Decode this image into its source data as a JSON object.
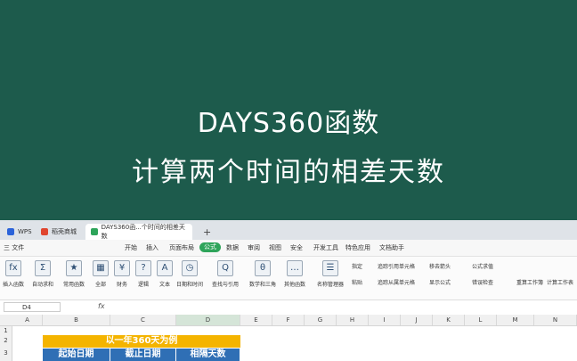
{
  "banner": {
    "line1": "DAYS360函数",
    "line2": "计算两个时间的相差天数"
  },
  "tabs": [
    {
      "label": "WPS"
    },
    {
      "label": "稻壳商城"
    },
    {
      "label": "DAYS360函...个时间的相差天数"
    }
  ],
  "menu": [
    "三 文件",
    "开始",
    "插入",
    "页面布局",
    "公式",
    "数据",
    "审阅",
    "视图",
    "安全",
    "开发工具",
    "特色应用",
    "文档助手"
  ],
  "ribbon": [
    {
      "icon": "fx",
      "label": "插入函数"
    },
    {
      "icon": "Σ",
      "label": "自动求和"
    },
    {
      "icon": "★",
      "label": "常用函数"
    },
    {
      "icon": "▦",
      "label": "全部"
    },
    {
      "icon": "¥",
      "label": "财务"
    },
    {
      "icon": "?",
      "label": "逻辑"
    },
    {
      "icon": "A",
      "label": "文本"
    },
    {
      "icon": "◷",
      "label": "日期和时间"
    },
    {
      "icon": "Q",
      "label": "查找与引用"
    },
    {
      "icon": "θ",
      "label": "数学和三角"
    },
    {
      "icon": "…",
      "label": "其他函数"
    },
    {
      "icon": "☰",
      "label": "名称管理器"
    }
  ],
  "ribbon_small": [
    "指定",
    "粘贴",
    "追踪引用单元格",
    "追踪从属单元格",
    "移去箭头",
    "显示公式",
    "公式求值",
    "错误检查",
    "重算工作簿",
    "计算工作表"
  ],
  "namebox": "D4",
  "fx": "fx",
  "columns": [
    "A",
    "B",
    "C",
    "D",
    "E",
    "F",
    "G",
    "H",
    "I",
    "J",
    "K",
    "L",
    "M",
    "N"
  ],
  "rows": [
    "1",
    "2",
    "3"
  ],
  "table": {
    "header": "以一年360天为例",
    "cols": [
      "起始日期",
      "截止日期",
      "相隔天数"
    ]
  }
}
